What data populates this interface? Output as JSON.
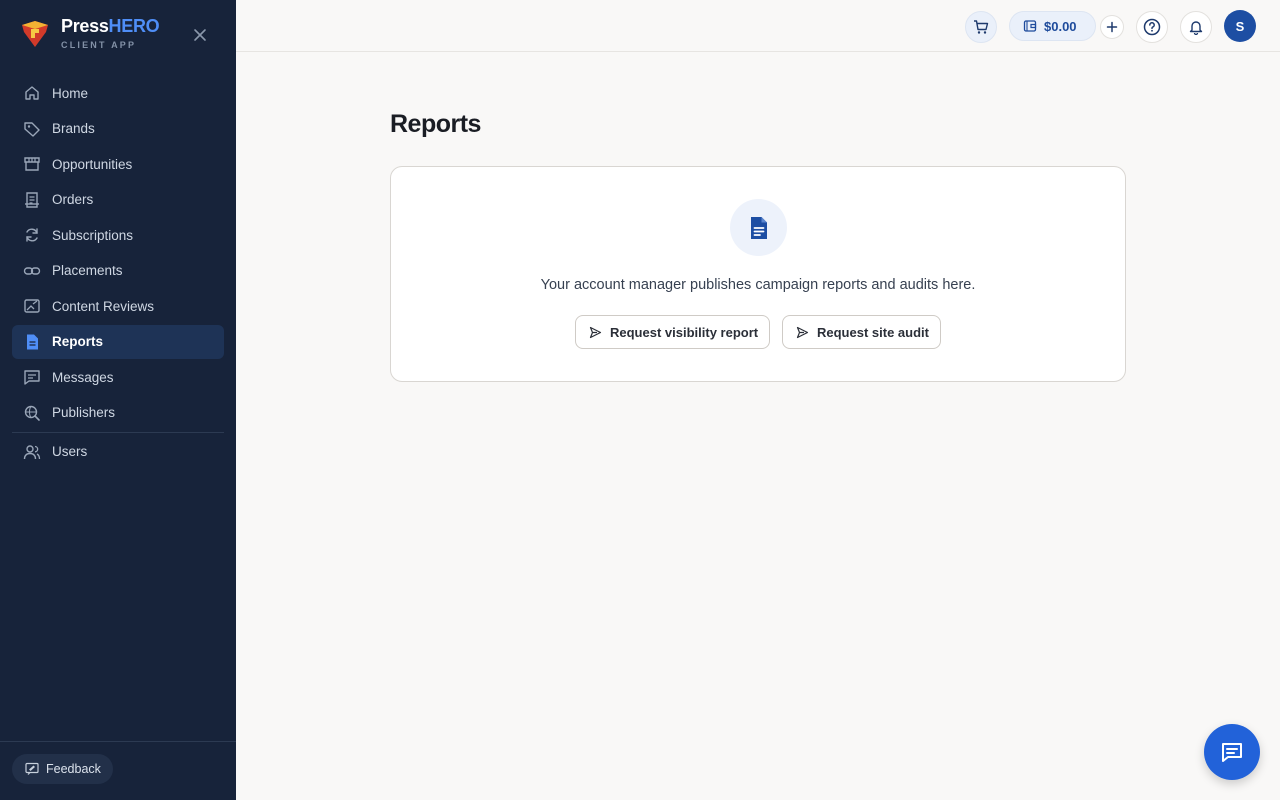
{
  "app": {
    "brand_press": "Press",
    "brand_hero": "HERO",
    "brand_subtitle": "CLIENT APP"
  },
  "sidebar": {
    "items": [
      {
        "label": "Home",
        "icon": "home-icon"
      },
      {
        "label": "Brands",
        "icon": "tag-icon"
      },
      {
        "label": "Opportunities",
        "icon": "storefront-icon"
      },
      {
        "label": "Orders",
        "icon": "receipt-icon"
      },
      {
        "label": "Subscriptions",
        "icon": "refresh-icon"
      },
      {
        "label": "Placements",
        "icon": "link-icon"
      },
      {
        "label": "Content Reviews",
        "icon": "image-edit-icon"
      },
      {
        "label": "Reports",
        "icon": "document-icon",
        "active": true
      },
      {
        "label": "Messages",
        "icon": "message-icon"
      },
      {
        "label": "Publishers",
        "icon": "search-globe-icon"
      },
      {
        "label": "Users",
        "icon": "users-icon"
      }
    ],
    "feedback_label": "Feedback"
  },
  "topbar": {
    "balance": "$0.00",
    "avatar_initial": "S"
  },
  "main": {
    "title": "Reports",
    "empty_message": "Your account manager publishes campaign reports and audits here.",
    "btn_visibility": "Request visibility report",
    "btn_audit": "Request site audit"
  },
  "colors": {
    "sidebar_bg": "#17233a",
    "active_bg": "#1e3356",
    "accent": "#2262d9",
    "brand_hero": "#4f8ef7"
  }
}
